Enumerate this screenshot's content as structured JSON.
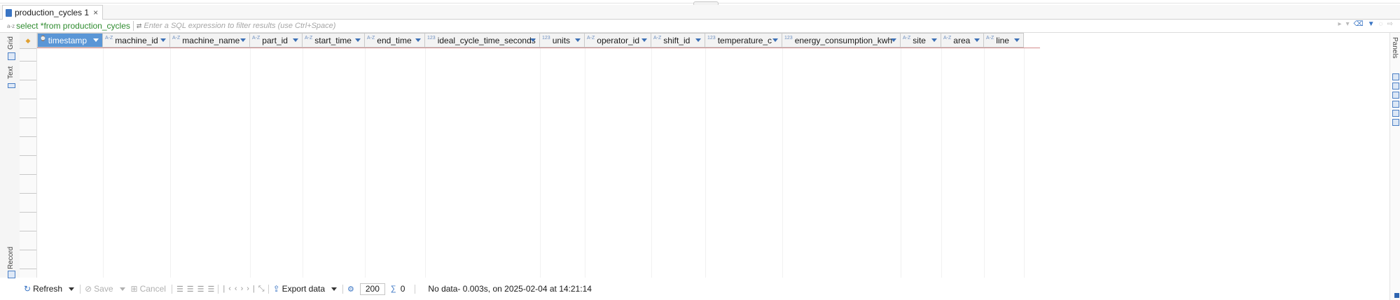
{
  "tab": {
    "title": "production_cycles 1",
    "close": "×"
  },
  "filter": {
    "sql_icon": "a-z",
    "sql": "select *from production_cycles",
    "filter_icon": "filter-expression-icon",
    "placeholder": "Enter a SQL expression to filter results (use Ctrl+Space)"
  },
  "left_tabs": {
    "grid": "Grid",
    "text": "Text",
    "record": "Record"
  },
  "right_tabs": {
    "panels": "Panels"
  },
  "columns": [
    {
      "type": "⌚",
      "name": "timestamp",
      "selected": true
    },
    {
      "type": "A-Z",
      "name": "machine_id"
    },
    {
      "type": "A-Z",
      "name": "machine_name"
    },
    {
      "type": "A-Z",
      "name": "part_id"
    },
    {
      "type": "A-Z",
      "name": "start_time"
    },
    {
      "type": "A-Z",
      "name": "end_time"
    },
    {
      "type": "123",
      "name": "ideal_cycle_time_seconds"
    },
    {
      "type": "123",
      "name": "units"
    },
    {
      "type": "A-Z",
      "name": "operator_id"
    },
    {
      "type": "A-Z",
      "name": "shift_id"
    },
    {
      "type": "123",
      "name": "temperature_c"
    },
    {
      "type": "123",
      "name": "energy_consumption_kwh"
    },
    {
      "type": "A-Z",
      "name": "site"
    },
    {
      "type": "A-Z",
      "name": "area"
    },
    {
      "type": "A-Z",
      "name": "line"
    }
  ],
  "status": {
    "refresh": "Refresh",
    "save": "Save",
    "cancel": "Cancel",
    "export": "Export data",
    "fetch_size": "200",
    "row_count": "0",
    "message": "No data- 0.003s, on 2025-02-04 at 14:21:14"
  },
  "colors": {
    "accent": "#3a75c4",
    "selected_header": "#5a96d6",
    "sql_text": "#2e8b2e"
  }
}
